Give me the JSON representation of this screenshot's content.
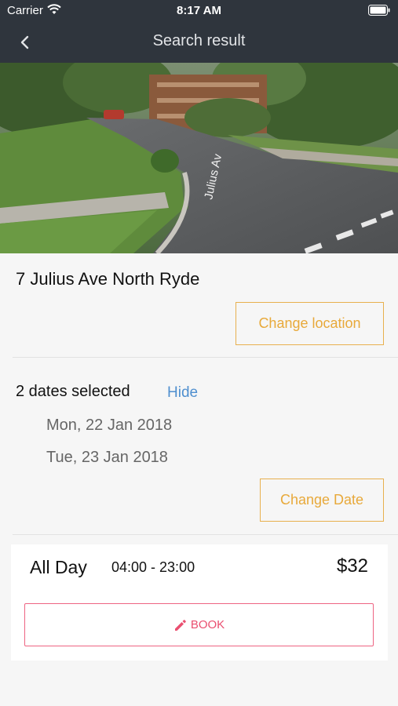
{
  "status_bar": {
    "carrier": "Carrier",
    "time": "8:17 AM"
  },
  "nav": {
    "title": "Search result",
    "back_icon": "chevron-left-icon"
  },
  "hero": {
    "street_sign": "Julius Av"
  },
  "location": {
    "address": "7 Julius Ave North Ryde",
    "change_label": "Change location"
  },
  "dates": {
    "summary": "2 dates selected",
    "toggle_label": "Hide",
    "items": [
      "Mon, 22 Jan 2018",
      "Tue, 23 Jan 2018"
    ],
    "change_label": "Change Date"
  },
  "booking": {
    "label": "All Day",
    "hours": "04:00 - 23:00",
    "price": "$32",
    "book_label": "BOOK",
    "book_icon": "pencil-icon"
  },
  "colors": {
    "header_bg": "#2f353d",
    "accent_orange": "#e8a93a",
    "link_blue": "#4f8fcf",
    "book_pink": "#ea4f70",
    "page_bg": "#f6f6f6"
  }
}
